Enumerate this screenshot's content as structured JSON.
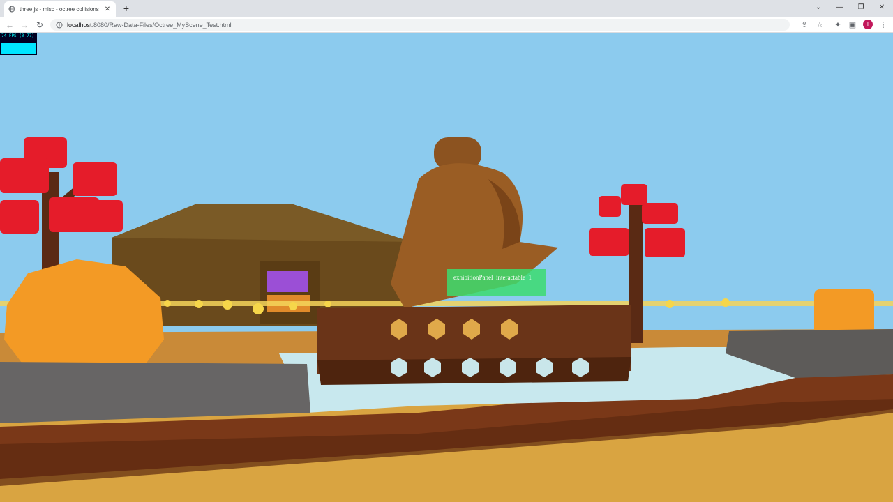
{
  "browser": {
    "tab_title": "three.js - misc - octree collisions",
    "new_tab_icon": "plus-icon",
    "url_host": "localhost",
    "url_path": ":8080/Raw-Data-Files/Octree_MyScene_Test.html",
    "profile_initial": "T"
  },
  "stats": {
    "fps_label": "74 FPS (0-77)"
  },
  "scene": {
    "interactable_label": "exhibitionPanel_interactable_1",
    "sky_color": "#8ccbee",
    "ground_color": "#d9a441"
  }
}
